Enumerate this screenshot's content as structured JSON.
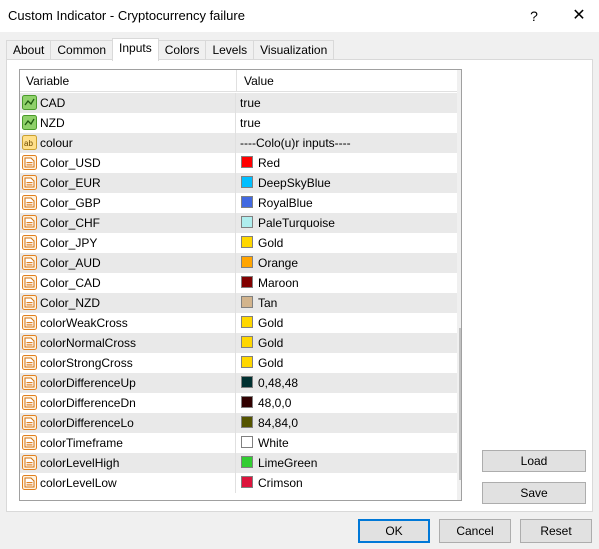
{
  "window": {
    "title": "Custom Indicator - Cryptocurrency failure",
    "help_glyph": "?",
    "close_glyph": "✕"
  },
  "tabs": [
    {
      "label": "About"
    },
    {
      "label": "Common"
    },
    {
      "label": "Inputs",
      "active": true
    },
    {
      "label": "Colors"
    },
    {
      "label": "Levels"
    },
    {
      "label": "Visualization"
    }
  ],
  "grid": {
    "header_variable": "Variable",
    "header_value": "Value",
    "rows": [
      {
        "variable": "CAD",
        "value": "true",
        "icon": "bool-icon"
      },
      {
        "variable": "NZD",
        "value": "true",
        "icon": "bool-icon"
      },
      {
        "variable": "colour",
        "value": "----Colo(u)r inputs----",
        "icon": "string-icon"
      },
      {
        "variable": "Color_USD",
        "value": "Red",
        "icon": "color-icon",
        "swatch": "#ff0000"
      },
      {
        "variable": "Color_EUR",
        "value": "DeepSkyBlue",
        "icon": "color-icon",
        "swatch": "#00bfff"
      },
      {
        "variable": "Color_GBP",
        "value": "RoyalBlue",
        "icon": "color-icon",
        "swatch": "#4169e1"
      },
      {
        "variable": "Color_CHF",
        "value": "PaleTurquoise",
        "icon": "color-icon",
        "swatch": "#afeeee"
      },
      {
        "variable": "Color_JPY",
        "value": "Gold",
        "icon": "color-icon",
        "swatch": "#ffd700"
      },
      {
        "variable": "Color_AUD",
        "value": "Orange",
        "icon": "color-icon",
        "swatch": "#ffa500"
      },
      {
        "variable": "Color_CAD",
        "value": "Maroon",
        "icon": "color-icon",
        "swatch": "#800000"
      },
      {
        "variable": "Color_NZD",
        "value": "Tan",
        "icon": "color-icon",
        "swatch": "#d2b48c"
      },
      {
        "variable": "colorWeakCross",
        "value": "Gold",
        "icon": "color-icon",
        "swatch": "#ffd700"
      },
      {
        "variable": "colorNormalCross",
        "value": "Gold",
        "icon": "color-icon",
        "swatch": "#ffd700"
      },
      {
        "variable": "colorStrongCross",
        "value": "Gold",
        "icon": "color-icon",
        "swatch": "#ffd700"
      },
      {
        "variable": "colorDifferenceUp",
        "value": "0,48,48",
        "icon": "color-icon",
        "swatch": "#003030"
      },
      {
        "variable": "colorDifferenceDn",
        "value": "48,0,0",
        "icon": "color-icon",
        "swatch": "#300000"
      },
      {
        "variable": "colorDifferenceLo",
        "value": "84,84,0",
        "icon": "color-icon",
        "swatch": "#545400"
      },
      {
        "variable": "colorTimeframe",
        "value": "White",
        "icon": "color-icon",
        "swatch": "#ffffff"
      },
      {
        "variable": "colorLevelHigh",
        "value": "LimeGreen",
        "icon": "color-icon",
        "swatch": "#32cd32"
      },
      {
        "variable": "colorLevelLow",
        "value": "Crimson",
        "icon": "color-icon",
        "swatch": "#dc143c"
      }
    ]
  },
  "buttons": {
    "load": "Load",
    "save": "Save",
    "ok": "OK",
    "cancel": "Cancel",
    "reset": "Reset"
  },
  "colors": {
    "accent": "#0078d7",
    "row_alt": "#e9e9e9"
  }
}
